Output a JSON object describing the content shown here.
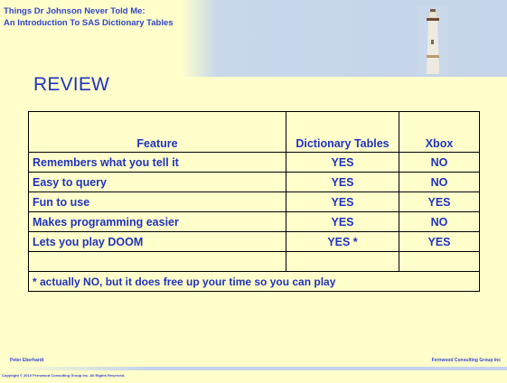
{
  "header": {
    "title_line1": "Things Dr Johnson Never Told Me:",
    "title_line2": "An Introduction To SAS Dictionary Tables"
  },
  "slide": {
    "heading": "REVIEW"
  },
  "table": {
    "columns": [
      "Feature",
      "Dictionary Tables",
      "Xbox"
    ],
    "rows": [
      {
        "feature": "Remembers what you tell it",
        "dictionary": "YES",
        "xbox": "NO"
      },
      {
        "feature": "Easy to query",
        "dictionary": "YES",
        "xbox": "NO"
      },
      {
        "feature": "Fun to use",
        "dictionary": "YES",
        "xbox": "YES"
      },
      {
        "feature": "Makes programming easier",
        "dictionary": "YES",
        "xbox": "NO"
      },
      {
        "feature": "Lets you play DOOM",
        "dictionary": "YES *",
        "xbox": "YES"
      }
    ],
    "footnote": "* actually NO, but it does free up your time so you can play"
  },
  "footer": {
    "author": "Peter Eberhardt",
    "company": "Fernwood Consulting Group Inc",
    "copyright": "Copyright © 2010 Fernwood Consulting Group Inc. All Rights Reserved."
  },
  "colors": {
    "background": "#ffffcc",
    "accent": "#2233bb",
    "band": "#c5d4e8"
  },
  "icons": {
    "header_image": "lighthouse-icon"
  }
}
